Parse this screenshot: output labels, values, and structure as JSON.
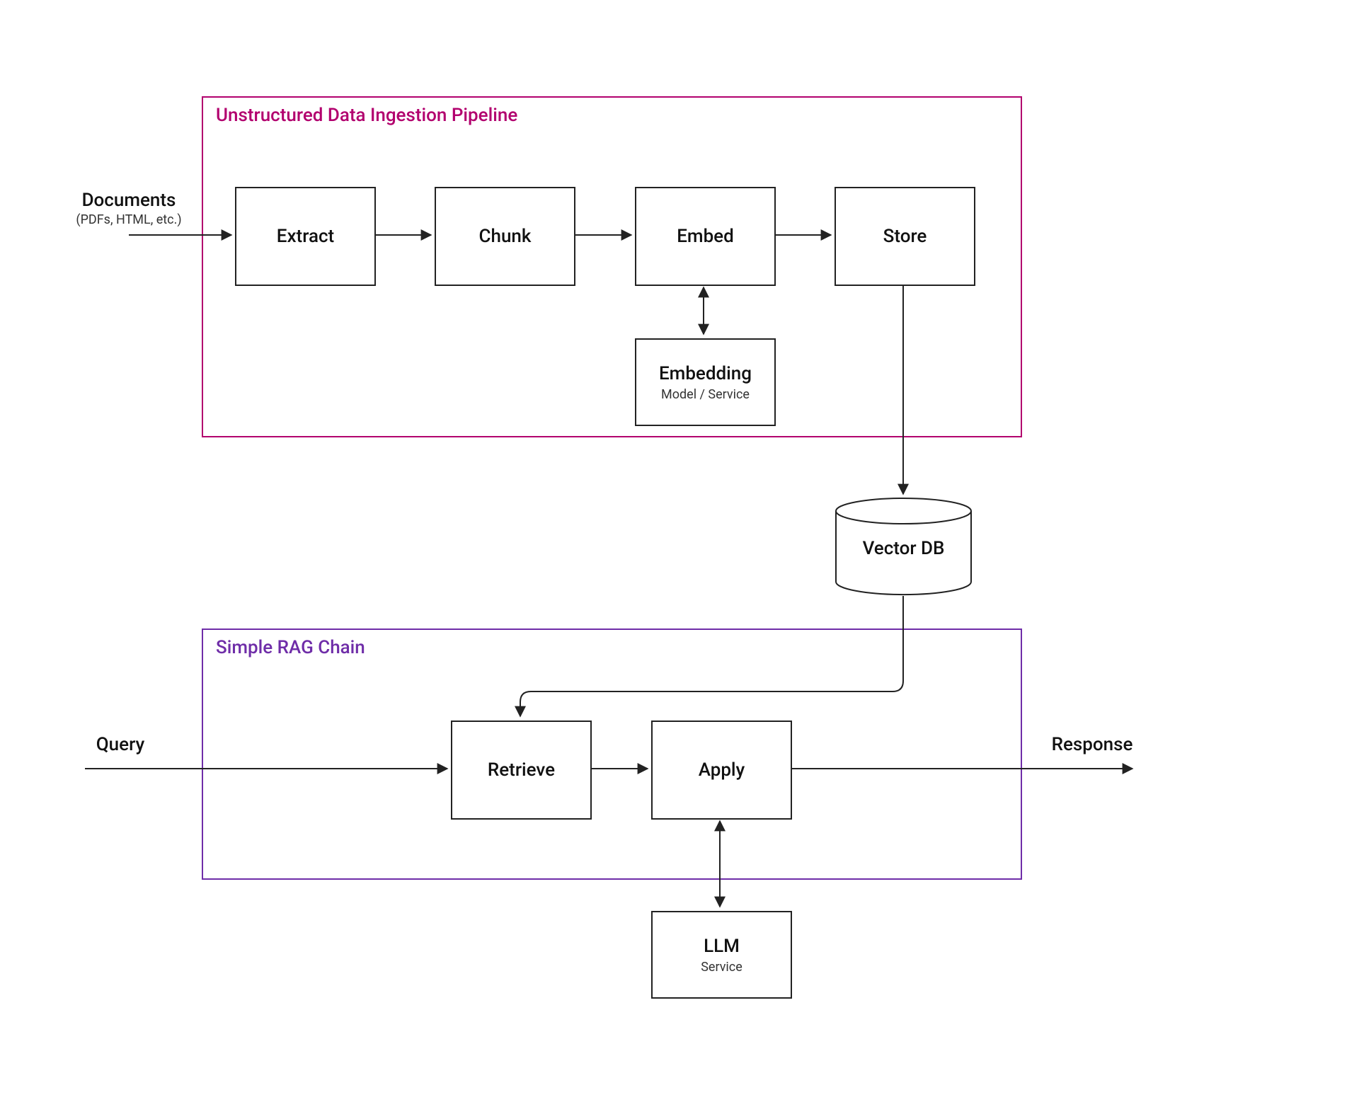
{
  "colors": {
    "pipeline_border": "#b2006e",
    "pipeline_title": "#b2006e",
    "chain_border": "#6f2da8",
    "chain_title": "#6f2da8",
    "node_border": "#222222",
    "arrow_stroke": "#222222"
  },
  "groups": {
    "pipeline": {
      "title": "Unstructured Data Ingestion Pipeline"
    },
    "chain": {
      "title": "Simple RAG Chain"
    }
  },
  "nodes": {
    "documents": {
      "title": "Documents",
      "sub": "(PDFs, HTML, etc.)"
    },
    "extract": {
      "title": "Extract"
    },
    "chunk": {
      "title": "Chunk"
    },
    "embed": {
      "title": "Embed"
    },
    "store": {
      "title": "Store"
    },
    "embedding": {
      "title": "Embedding",
      "sub": "Model / Service"
    },
    "vectordb": {
      "title": "Vector DB"
    },
    "retrieve": {
      "title": "Retrieve"
    },
    "apply": {
      "title": "Apply"
    },
    "llm": {
      "title": "LLM",
      "sub": "Service"
    },
    "query": {
      "title": "Query"
    },
    "response": {
      "title": "Response"
    }
  }
}
